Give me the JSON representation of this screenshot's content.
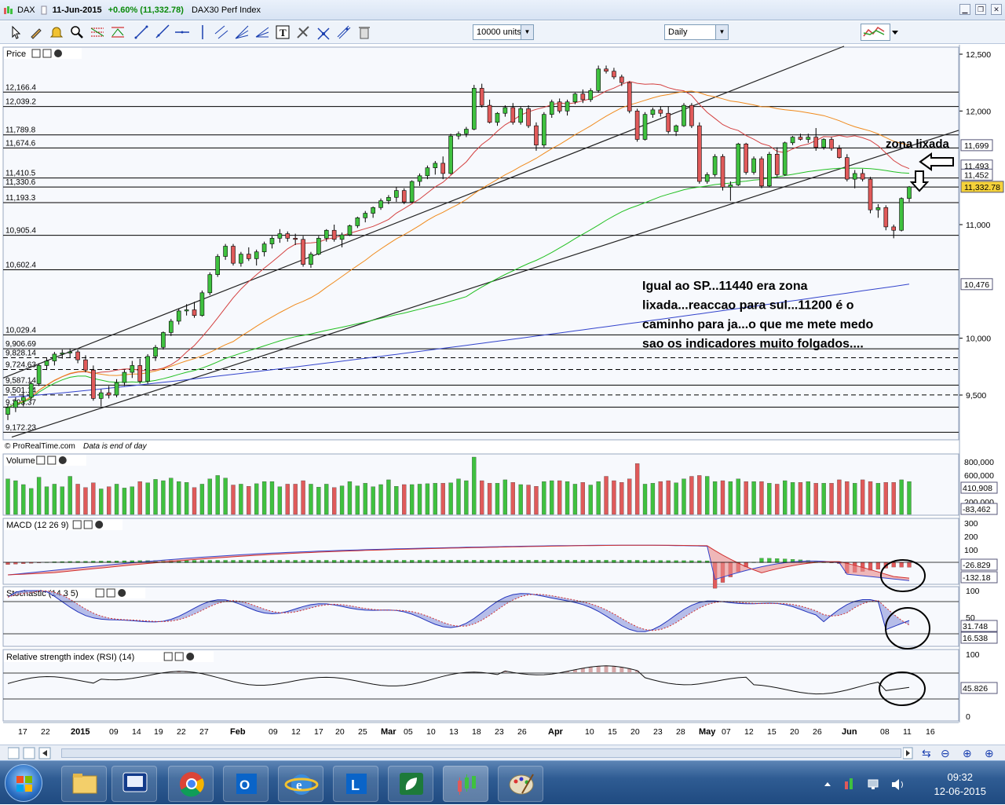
{
  "window": {
    "symbol": "DAX",
    "date": "11-Jun-2015",
    "change": "+0.60% (11,332.78)",
    "instrument": "DAX30 Perf Index"
  },
  "toolbar": {
    "units_value": "10000 units",
    "timeframe_value": "Daily",
    "tools": [
      "cursor-icon",
      "pencil-icon",
      "alarm-bell-icon",
      "zoom-icon",
      "fibonacci-icon",
      "retracement-icon",
      "trendline-icon",
      "ray-icon",
      "horizontal-line-icon",
      "vertical-line-icon",
      "channel-icon",
      "fan-icon",
      "pitchfork-icon",
      "text-icon",
      "measure-icon",
      "delete-icon"
    ]
  },
  "panels": {
    "price": "Price",
    "volume": "Volume",
    "macd": "MACD (12 26 9)",
    "stochastic": "Stochastic (14 3 5)",
    "rsi": "Relative strength index (RSI) (14)"
  },
  "footer": {
    "source": "© ProRealTime.com",
    "note": "Data is end of day"
  },
  "annotations": {
    "zone": "zona lixada",
    "comment_lines": [
      "Igual ao SP...11440 era zona",
      "lixada...reaccao para sul...11200 é o",
      "caminho para ja...o que me mete medo",
      "sao os indicadores muito folgados...."
    ]
  },
  "levels": [
    "12,166.4",
    "12,039.2",
    "11,789.8",
    "11,674.6",
    "11,410.5",
    "11,330.6",
    "11,193.3",
    "10,905.4",
    "10,602.4",
    "10,029.4",
    "9,906.69",
    "9,828.14",
    "9,724.63",
    "9,587.14",
    "9,501.14",
    "9,393.37",
    "9,172.23"
  ],
  "price_axis": {
    "ticks": [
      "12,500",
      "12,000",
      "11,000",
      "10,000",
      "9,500"
    ],
    "badges": {
      "ma_orange": "11,699",
      "ma_red": "11,493",
      "ma_green": "11,452",
      "last": "11,332.78",
      "ma_blue": "10,476"
    }
  },
  "volume_axis": {
    "ticks": [
      "800,000",
      "600,000",
      "200,000"
    ],
    "badges": {
      "volume": "410,908",
      "ma": "-83,462"
    }
  },
  "macd_axis": {
    "ticks": [
      "300",
      "200",
      "100"
    ],
    "badges": {
      "macd": "-26.829",
      "signal": "-132.18"
    }
  },
  "stoch_axis": {
    "ticks": [
      "100",
      "50"
    ],
    "badges": {
      "k": "31.748",
      "d": "16.538"
    }
  },
  "rsi_axis": {
    "ticks": [
      "100",
      "0"
    ],
    "badges": {
      "rsi": "45.826"
    }
  },
  "date_axis": {
    "labels": [
      "17",
      "22",
      "2015",
      "09",
      "14",
      "19",
      "22",
      "27",
      "Feb",
      "09",
      "12",
      "17",
      "20",
      "25",
      "Mar",
      "05",
      "10",
      "13",
      "18",
      "23",
      "26",
      "Apr",
      "10",
      "15",
      "20",
      "23",
      "28",
      "May",
      "07",
      "12",
      "15",
      "20",
      "26",
      "Jun",
      "08",
      "11",
      "16"
    ]
  },
  "colors": {
    "bull": "#3fc13f",
    "bear": "#e05a5a",
    "ma20": "#d44040",
    "ma50": "#f08a1c",
    "ma100": "#22c022",
    "ma200": "#3344cc",
    "last_badge": "#f5d23a"
  },
  "chart_data": {
    "type": "candlestick",
    "instrument": "DAX30 Perf Index",
    "timeframe": "Daily",
    "ylim": [
      9100,
      12550
    ],
    "candles": [
      [
        9330,
        9420,
        9280,
        9390
      ],
      [
        9390,
        9480,
        9350,
        9450
      ],
      [
        9450,
        9520,
        9400,
        9480
      ],
      [
        9480,
        9620,
        9450,
        9600
      ],
      [
        9600,
        9780,
        9580,
        9760
      ],
      [
        9760,
        9830,
        9720,
        9800
      ],
      [
        9800,
        9880,
        9760,
        9860
      ],
      [
        9860,
        9900,
        9820,
        9870
      ],
      [
        9870,
        9910,
        9830,
        9880
      ],
      [
        9880,
        9900,
        9780,
        9810
      ],
      [
        9810,
        9850,
        9700,
        9720
      ],
      [
        9720,
        9760,
        9450,
        9470
      ],
      [
        9470,
        9550,
        9400,
        9520
      ],
      [
        9520,
        9580,
        9470,
        9500
      ],
      [
        9500,
        9640,
        9480,
        9610
      ],
      [
        9610,
        9720,
        9580,
        9700
      ],
      [
        9700,
        9800,
        9650,
        9760
      ],
      [
        9760,
        9820,
        9600,
        9620
      ],
      [
        9620,
        9860,
        9600,
        9840
      ],
      [
        9840,
        9940,
        9800,
        9920
      ],
      [
        9920,
        10060,
        9900,
        10050
      ],
      [
        10050,
        10170,
        10020,
        10150
      ],
      [
        10150,
        10260,
        10120,
        10240
      ],
      [
        10240,
        10300,
        10200,
        10250
      ],
      [
        10250,
        10320,
        10180,
        10200
      ],
      [
        10200,
        10420,
        10190,
        10400
      ],
      [
        10400,
        10580,
        10380,
        10560
      ],
      [
        10560,
        10740,
        10540,
        10720
      ],
      [
        10720,
        10830,
        10690,
        10810
      ],
      [
        10810,
        10830,
        10640,
        10660
      ],
      [
        10660,
        10760,
        10630,
        10740
      ],
      [
        10740,
        10800,
        10680,
        10700
      ],
      [
        10700,
        10780,
        10640,
        10760
      ],
      [
        10760,
        10850,
        10720,
        10830
      ],
      [
        10830,
        10900,
        10790,
        10880
      ],
      [
        10880,
        10960,
        10840,
        10920
      ],
      [
        10920,
        10940,
        10850,
        10880
      ],
      [
        10880,
        10920,
        10820,
        10870
      ],
      [
        10870,
        10900,
        10630,
        10650
      ],
      [
        10650,
        10760,
        10620,
        10740
      ],
      [
        10740,
        10900,
        10730,
        10880
      ],
      [
        10880,
        10960,
        10850,
        10950
      ],
      [
        10950,
        11000,
        10850,
        10870
      ],
      [
        10870,
        10930,
        10800,
        10910
      ],
      [
        10910,
        11000,
        10900,
        10990
      ],
      [
        10990,
        11070,
        10970,
        11060
      ],
      [
        11060,
        11120,
        11020,
        11100
      ],
      [
        11100,
        11160,
        11060,
        11150
      ],
      [
        11150,
        11230,
        11130,
        11210
      ],
      [
        11210,
        11260,
        11180,
        11240
      ],
      [
        11240,
        11330,
        11200,
        11300
      ],
      [
        11300,
        11320,
        11180,
        11200
      ],
      [
        11200,
        11390,
        11190,
        11380
      ],
      [
        11380,
        11450,
        11340,
        11430
      ],
      [
        11430,
        11520,
        11400,
        11500
      ],
      [
        11500,
        11560,
        11440,
        11540
      ],
      [
        11540,
        11600,
        11400,
        11450
      ],
      [
        11450,
        11800,
        11440,
        11780
      ],
      [
        11780,
        11820,
        11750,
        11800
      ],
      [
        11800,
        11860,
        11770,
        11840
      ],
      [
        11840,
        12230,
        11830,
        12200
      ],
      [
        12200,
        12240,
        12030,
        12050
      ],
      [
        12050,
        12100,
        11890,
        11900
      ],
      [
        11900,
        11990,
        11870,
        11980
      ],
      [
        11980,
        12050,
        11950,
        12030
      ],
      [
        12030,
        12070,
        11880,
        11900
      ],
      [
        11900,
        12040,
        11880,
        12020
      ],
      [
        12020,
        12050,
        11850,
        11870
      ],
      [
        11870,
        11900,
        11650,
        11700
      ],
      [
        11700,
        11990,
        11680,
        11970
      ],
      [
        11970,
        12100,
        11940,
        12080
      ],
      [
        12080,
        12110,
        11980,
        12000
      ],
      [
        12000,
        12100,
        11960,
        12080
      ],
      [
        12080,
        12160,
        12060,
        12150
      ],
      [
        12150,
        12190,
        12070,
        12100
      ],
      [
        12100,
        12200,
        12080,
        12180
      ],
      [
        12180,
        12400,
        12160,
        12370
      ],
      [
        12370,
        12400,
        12330,
        12350
      ],
      [
        12350,
        12380,
        12280,
        12300
      ],
      [
        12300,
        12320,
        12220,
        12250
      ],
      [
        12250,
        12260,
        11980,
        12000
      ],
      [
        12000,
        12020,
        11730,
        11750
      ],
      [
        11750,
        11990,
        11740,
        11970
      ],
      [
        11970,
        12030,
        11940,
        12010
      ],
      [
        12010,
        12040,
        11950,
        11980
      ],
      [
        11980,
        12040,
        11800,
        11820
      ],
      [
        11820,
        11880,
        11780,
        11870
      ],
      [
        11870,
        12070,
        11860,
        12050
      ],
      [
        12050,
        12070,
        11850,
        11870
      ],
      [
        11870,
        11900,
        11360,
        11380
      ],
      [
        11380,
        11460,
        11360,
        11440
      ],
      [
        11440,
        11620,
        11420,
        11600
      ],
      [
        11600,
        11620,
        11300,
        11330
      ],
      [
        11330,
        11380,
        11210,
        11350
      ],
      [
        11350,
        11720,
        11340,
        11710
      ],
      [
        11710,
        11720,
        11440,
        11460
      ],
      [
        11460,
        11600,
        11440,
        11580
      ],
      [
        11580,
        11600,
        11320,
        11340
      ],
      [
        11340,
        11640,
        11330,
        11620
      ],
      [
        11620,
        11680,
        11420,
        11440
      ],
      [
        11440,
        11730,
        11430,
        11720
      ],
      [
        11720,
        11780,
        11700,
        11770
      ],
      [
        11770,
        11800,
        11740,
        11750
      ],
      [
        11750,
        11800,
        11720,
        11770
      ],
      [
        11770,
        11850,
        11650,
        11680
      ],
      [
        11680,
        11760,
        11660,
        11750
      ],
      [
        11750,
        11770,
        11650,
        11670
      ],
      [
        11670,
        11700,
        11580,
        11590
      ],
      [
        11590,
        11620,
        11380,
        11400
      ],
      [
        11400,
        11480,
        11320,
        11450
      ],
      [
        11450,
        11490,
        11380,
        11400
      ],
      [
        11400,
        11420,
        11100,
        11130
      ],
      [
        11130,
        11180,
        11060,
        11150
      ],
      [
        11150,
        11170,
        10950,
        10980
      ],
      [
        10980,
        11000,
        10880,
        10950
      ],
      [
        10950,
        11240,
        10940,
        11230
      ],
      [
        11230,
        11340,
        11200,
        11332
      ]
    ],
    "volume": [
      820,
      780,
      690,
      600,
      860,
      640,
      700,
      640,
      880,
      700,
      620,
      730,
      590,
      640,
      700,
      610,
      640,
      760,
      730,
      810,
      780,
      840,
      760,
      740,
      620,
      700,
      820,
      900,
      840,
      680,
      700,
      650,
      710,
      760,
      760,
      640,
      700,
      700,
      780,
      700,
      630,
      700,
      620,
      660,
      760,
      660,
      720,
      640,
      690,
      800,
      650,
      690,
      690,
      700,
      710,
      720,
      720,
      730,
      820,
      780,
      1060,
      780,
      720,
      720,
      800,
      740,
      690,
      680,
      650,
      760,
      780,
      780,
      760,
      700,
      740,
      680,
      760,
      880,
      780,
      740,
      820,
      940,
      700,
      720,
      760,
      780,
      730,
      820,
      880,
      900,
      880,
      760,
      780,
      760,
      820,
      760,
      760,
      760,
      720,
      700,
      780,
      740,
      740,
      760,
      720,
      720,
      720,
      800,
      760,
      720,
      800,
      760,
      720,
      740,
      740,
      800,
      760
    ],
    "moving_averages": [
      {
        "period": 20,
        "last": 11493
      },
      {
        "period": 50,
        "last": 11699
      },
      {
        "period": 100,
        "last": 11452
      },
      {
        "period": 200,
        "last": 10476
      }
    ],
    "macd": {
      "macd": -26.829,
      "signal": -132.18
    },
    "stochastic": {
      "k": 31.748,
      "d": 16.538
    },
    "rsi": 45.826
  }
}
